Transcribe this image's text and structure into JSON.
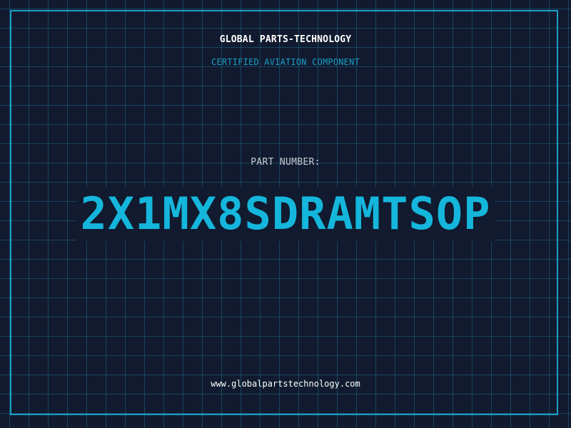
{
  "header": {
    "company": "GLOBAL PARTS-TECHNOLOGY",
    "subtitle": "CERTIFIED AVIATION COMPONENT"
  },
  "main": {
    "part_label": "PART NUMBER:",
    "part_number": "2X1MX8SDRAMTSOP"
  },
  "footer": {
    "url": "www.globalpartstechnology.com"
  },
  "colors": {
    "background": "#111a2e",
    "grid": "#2278a0",
    "accent": "#1aa0c8",
    "part_number": "#15b6dc",
    "text": "#ffffff"
  }
}
